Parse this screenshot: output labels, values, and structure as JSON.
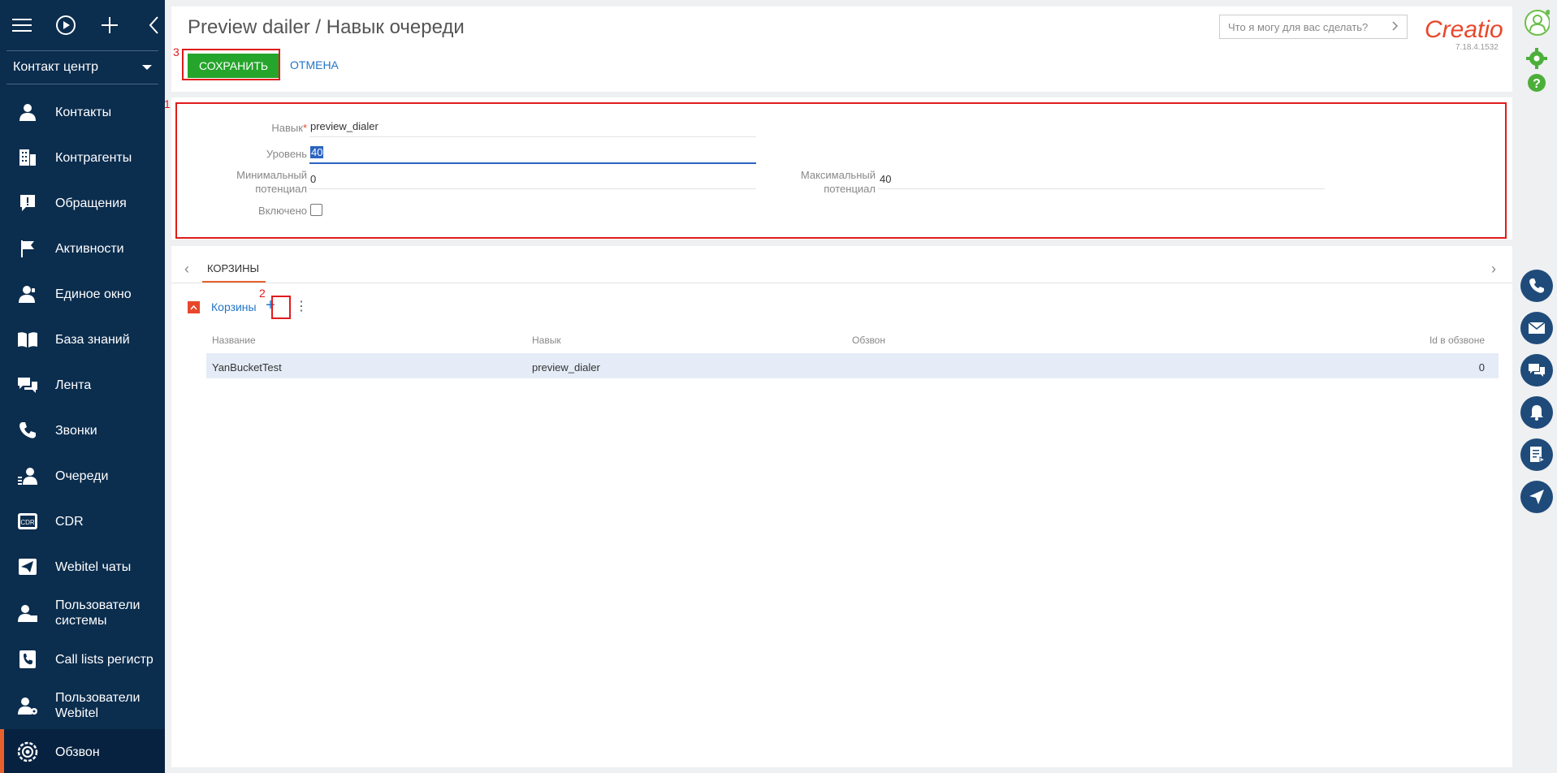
{
  "sidebar": {
    "workspace": "Контакт центр",
    "items": [
      {
        "label": "Контакты",
        "icon": "person-icon"
      },
      {
        "label": "Контрагенты",
        "icon": "building-icon"
      },
      {
        "label": "Обращения",
        "icon": "alert-icon"
      },
      {
        "label": "Активности",
        "icon": "flag-icon"
      },
      {
        "label": "Единое окно",
        "icon": "agent-icon"
      },
      {
        "label": "База знаний",
        "icon": "book-icon"
      },
      {
        "label": "Лента",
        "icon": "chat-icon"
      },
      {
        "label": "Звонки",
        "icon": "phone-icon"
      },
      {
        "label": "Очереди",
        "icon": "queue-icon"
      },
      {
        "label": "CDR",
        "icon": "cdr-icon"
      },
      {
        "label": "Webitel чаты",
        "icon": "send-icon"
      },
      {
        "label": "Пользователи системы",
        "icon": "user-lock-icon"
      },
      {
        "label": "Call lists регистр",
        "icon": "phone-book-icon"
      },
      {
        "label": "Пользователи Webitel",
        "icon": "user-gear-icon"
      },
      {
        "label": "Обзвон",
        "icon": "target-icon"
      }
    ]
  },
  "header": {
    "title": "Preview dailer / Навык очереди",
    "save_label": "СОХРАНИТЬ",
    "cancel_label": "ОТМЕНА",
    "search_placeholder": "Что я могу для вас сделать?",
    "logo_text": "Creatio",
    "version": "7.18.4.1532"
  },
  "form": {
    "skill_label": "Навык",
    "skill_value": "preview_dialer",
    "level_label": "Уровень",
    "level_value": "40",
    "min_label": "Минимальный потенциал",
    "min_value": "0",
    "max_label": "Максимальный потенциал",
    "max_value": "40",
    "enabled_label": "Включено",
    "enabled": false
  },
  "detail": {
    "tab_label": "КОРЗИНЫ",
    "group_label": "Корзины",
    "columns": [
      "Название",
      "Навык",
      "Обзвон",
      "Id в обзвоне"
    ],
    "rows": [
      {
        "name": "YanBucketTest",
        "skill": "preview_dialer",
        "dialer": "",
        "id": "0"
      }
    ]
  },
  "annotations": {
    "a1": "1",
    "a2": "2",
    "a3": "3"
  },
  "colors": {
    "accent": "#e8612c",
    "save": "#25a52b",
    "link": "#2376c7",
    "annotation": "#e01b1b"
  }
}
